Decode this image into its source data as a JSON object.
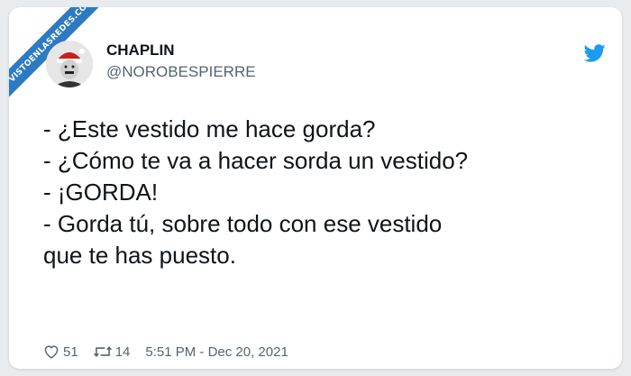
{
  "watermark": {
    "text": "VISTOENLASREDES.COM"
  },
  "author": {
    "display_name": "CHAPLIN",
    "handle": "@NOROBESPIERRE"
  },
  "tweet": {
    "lines": [
      "- ¿Este vestido me hace gorda?",
      "- ¿Cómo te va a hacer sorda un vestido?",
      "- ¡GORDA!",
      "- Gorda tú, sobre todo con ese vestido",
      "que te has puesto."
    ]
  },
  "stats": {
    "likes": "51",
    "retweets": "14",
    "timestamp": "5:51 PM - Dec 20, 2021"
  },
  "icons": {
    "logo": "twitter-bird-icon",
    "like": "heart-icon",
    "retweet": "retweet-icon"
  },
  "colors": {
    "twitter_blue": "#1d9bf0",
    "ribbon": "#2c7ac4",
    "text": "#0f1419",
    "muted": "#536471"
  }
}
